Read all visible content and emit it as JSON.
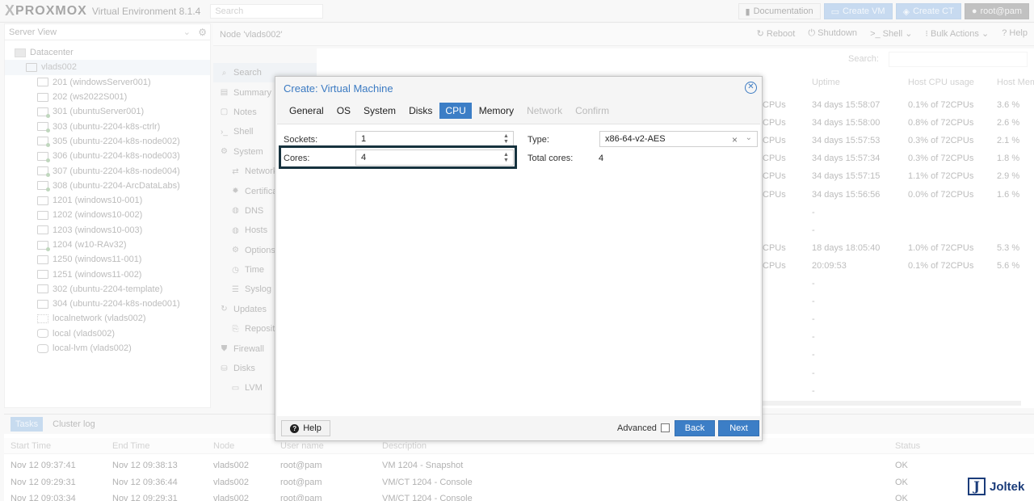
{
  "topbar": {
    "logo_x": "X",
    "logo_brand": "PROXMOX",
    "version": "Virtual Environment 8.1.4",
    "search_placeholder": "Search",
    "documentation": "Documentation",
    "create_vm": "Create VM",
    "create_ct": "Create CT",
    "user": "root@pam"
  },
  "tree": {
    "view": "Server View",
    "items": [
      {
        "label": "Datacenter",
        "icon": "datacenter-icon"
      },
      {
        "label": "vlads002",
        "icon": "server-icon"
      },
      {
        "label": "201 (windowsServer001)",
        "icon": "vm-icon"
      },
      {
        "label": "202 (ws2022S001)",
        "icon": "vm-icon"
      },
      {
        "label": "301 (ubuntuServer001)",
        "icon": "vm-running-icon"
      },
      {
        "label": "303 (ubuntu-2204-k8s-ctrlr)",
        "icon": "vm-running-icon"
      },
      {
        "label": "305 (ubuntu-2204-k8s-node002)",
        "icon": "vm-running-icon"
      },
      {
        "label": "306 (ubuntu-2204-k8s-node003)",
        "icon": "vm-running-icon"
      },
      {
        "label": "307 (ubuntu-2204-k8s-node004)",
        "icon": "vm-running-icon"
      },
      {
        "label": "308 (ubuntu-2204-ArcDataLabs)",
        "icon": "vm-running-icon"
      },
      {
        "label": "1201 (windows10-001)",
        "icon": "vm-icon"
      },
      {
        "label": "1202 (windows10-002)",
        "icon": "vm-icon"
      },
      {
        "label": "1203 (windows10-003)",
        "icon": "vm-icon"
      },
      {
        "label": "1204 (w10-RAv32)",
        "icon": "vm-running-icon"
      },
      {
        "label": "1250 (windows11-001)",
        "icon": "vm-icon"
      },
      {
        "label": "1251 (windows11-002)",
        "icon": "vm-icon"
      },
      {
        "label": "302 (ubuntu-2204-template)",
        "icon": "template-icon"
      },
      {
        "label": "304 (ubuntu-2204-k8s-node001)",
        "icon": "template-icon"
      },
      {
        "label": "localnetwork (vlads002)",
        "icon": "network-icon"
      },
      {
        "label": "local (vlads002)",
        "icon": "storage-icon"
      },
      {
        "label": "local-lvm (vlads002)",
        "icon": "storage-icon"
      }
    ]
  },
  "node_header": {
    "title": "Node 'vlads002'",
    "reboot": "Reboot",
    "shutdown": "Shutdown",
    "shell": "Shell",
    "bulk_actions": "Bulk Actions",
    "help": "Help"
  },
  "subnav": [
    {
      "label": "Search",
      "sub": false,
      "icon": "search-icon"
    },
    {
      "label": "Summary",
      "sub": false,
      "icon": "summary-icon"
    },
    {
      "label": "Notes",
      "sub": false,
      "icon": "notes-icon"
    },
    {
      "label": "Shell",
      "sub": false,
      "icon": "terminal-icon"
    },
    {
      "label": "System",
      "sub": false,
      "icon": "gears-icon"
    },
    {
      "label": "Network",
      "sub": true,
      "icon": "network-icon"
    },
    {
      "label": "Certificates",
      "sub": true,
      "icon": "certificate-icon"
    },
    {
      "label": "DNS",
      "sub": true,
      "icon": "globe-icon"
    },
    {
      "label": "Hosts",
      "sub": true,
      "icon": "globe-icon"
    },
    {
      "label": "Options",
      "sub": true,
      "icon": "gear-icon"
    },
    {
      "label": "Time",
      "sub": true,
      "icon": "clock-icon"
    },
    {
      "label": "Syslog",
      "sub": true,
      "icon": "list-icon"
    },
    {
      "label": "Updates",
      "sub": false,
      "icon": "refresh-icon"
    },
    {
      "label": "Repositories",
      "sub": true,
      "icon": "repository-icon"
    },
    {
      "label": "Firewall",
      "sub": false,
      "icon": "shield-icon"
    },
    {
      "label": "Disks",
      "sub": false,
      "icon": "disk-icon"
    },
    {
      "label": "LVM",
      "sub": true,
      "icon": "lvm-icon"
    }
  ],
  "bg_grid": {
    "search_label": "Search:",
    "columns": [
      "Uptime",
      "Host CPU usage",
      "Host Mem"
    ],
    "rows": [
      {
        "cpu": "CPUs",
        "uptime": "34 days 15:58:07",
        "hostcpu": "0.1% of 72CPUs",
        "mem": "3.6 %"
      },
      {
        "cpu": "CPUs",
        "uptime": "34 days 15:58:00",
        "hostcpu": "0.8% of 72CPUs",
        "mem": "2.6 %"
      },
      {
        "cpu": "CPUs",
        "uptime": "34 days 15:57:53",
        "hostcpu": "0.3% of 72CPUs",
        "mem": "2.1 %"
      },
      {
        "cpu": "CPUs",
        "uptime": "34 days 15:57:34",
        "hostcpu": "0.3% of 72CPUs",
        "mem": "1.8 %"
      },
      {
        "cpu": "CPUs",
        "uptime": "34 days 15:57:15",
        "hostcpu": "1.1% of 72CPUs",
        "mem": "2.9 %"
      },
      {
        "cpu": "CPUs",
        "uptime": "34 days 15:56:56",
        "hostcpu": "0.0% of 72CPUs",
        "mem": "1.6 %"
      },
      {
        "cpu": "",
        "uptime": "-",
        "hostcpu": "",
        "mem": ""
      },
      {
        "cpu": "",
        "uptime": "-",
        "hostcpu": "",
        "mem": ""
      },
      {
        "cpu": "CPUs",
        "uptime": "18 days 18:05:40",
        "hostcpu": "1.0% of 72CPUs",
        "mem": "5.3 %"
      },
      {
        "cpu": "CPUs",
        "uptime": "20:09:53",
        "hostcpu": "0.1% of 72CPUs",
        "mem": "5.6 %"
      },
      {
        "cpu": "",
        "uptime": "-",
        "hostcpu": "",
        "mem": ""
      },
      {
        "cpu": "",
        "uptime": "-",
        "hostcpu": "",
        "mem": ""
      },
      {
        "cpu": "",
        "uptime": "-",
        "hostcpu": "",
        "mem": ""
      },
      {
        "cpu": "",
        "uptime": "-",
        "hostcpu": "",
        "mem": ""
      },
      {
        "cpu": "",
        "uptime": "-",
        "hostcpu": "",
        "mem": ""
      },
      {
        "cpu": "",
        "uptime": "-",
        "hostcpu": "",
        "mem": ""
      },
      {
        "cpu": "",
        "uptime": "-",
        "hostcpu": "",
        "mem": ""
      }
    ]
  },
  "tasks": {
    "tabs": [
      "Tasks",
      "Cluster log"
    ],
    "columns": [
      "Start Time",
      "End Time",
      "Node",
      "User name",
      "Description",
      "Status"
    ],
    "rows": [
      [
        "Nov 12 09:37:41",
        "Nov 12 09:38:13",
        "vlads002",
        "root@pam",
        "VM 1204 - Snapshot",
        "OK"
      ],
      [
        "Nov 12 09:29:31",
        "Nov 12 09:36:44",
        "vlads002",
        "root@pam",
        "VM/CT 1204 - Console",
        "OK"
      ],
      [
        "Nov 12 09:03:34",
        "Nov 12 09:29:31",
        "vlads002",
        "root@pam",
        "VM/CT 1204 - Console",
        "OK"
      ]
    ]
  },
  "dialog": {
    "title": "Create: Virtual Machine",
    "tabs": [
      {
        "label": "General",
        "state": "normal"
      },
      {
        "label": "OS",
        "state": "normal"
      },
      {
        "label": "System",
        "state": "normal"
      },
      {
        "label": "Disks",
        "state": "normal"
      },
      {
        "label": "CPU",
        "state": "active"
      },
      {
        "label": "Memory",
        "state": "normal"
      },
      {
        "label": "Network",
        "state": "disabled"
      },
      {
        "label": "Confirm",
        "state": "disabled"
      }
    ],
    "sockets_label": "Sockets:",
    "sockets_value": "1",
    "cores_label": "Cores:",
    "cores_value": "4",
    "type_label": "Type:",
    "type_value": "x86-64-v2-AES",
    "total_cores_label": "Total cores:",
    "total_cores_value": "4",
    "help": "Help",
    "advanced": "Advanced",
    "back": "Back",
    "next": "Next"
  },
  "watermark": {
    "letter": "J",
    "text": "Joltek"
  },
  "colors": {
    "accent": "#3c7ec6",
    "highlight_border": "#16323e"
  }
}
